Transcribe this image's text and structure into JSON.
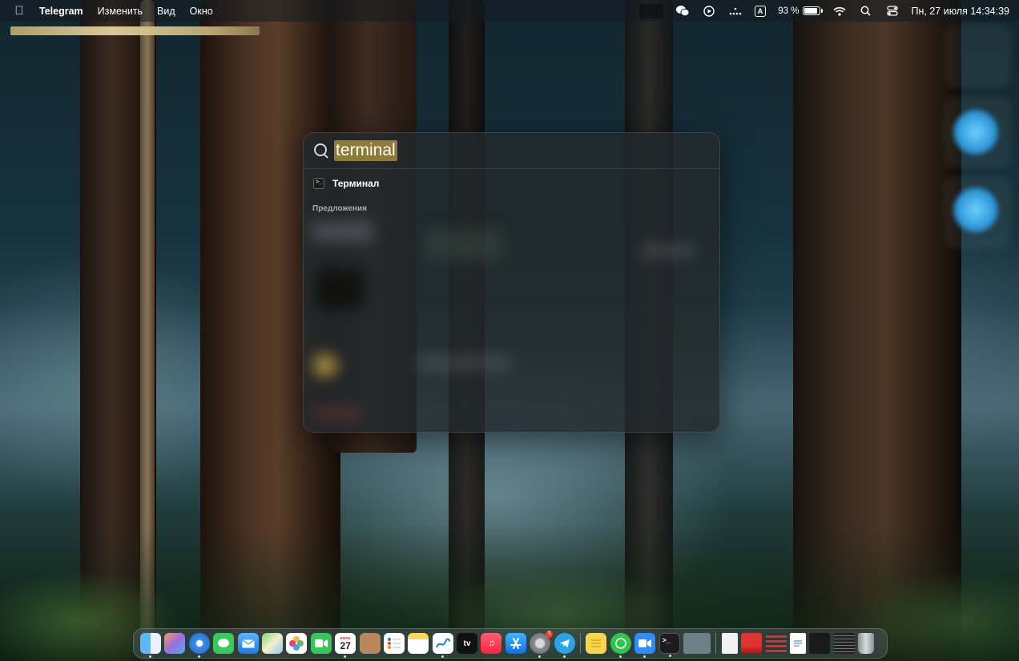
{
  "menubar": {
    "app_name": "Telegram",
    "menus": [
      "Изменить",
      "Вид",
      "Окно"
    ],
    "input_source": "A",
    "battery_percent": "93 %",
    "battery_level": 0.93,
    "datetime": "Пн, 27 июля  14:34:39",
    "icons": [
      "apple-icon",
      "wechat-icon",
      "play-icon",
      "dots-icon",
      "wifi-icon",
      "search-icon",
      "control-center-icon"
    ]
  },
  "spotlight": {
    "query": "terminal",
    "top_result": "Терминал",
    "suggestions_label": "Предложения"
  },
  "dock": {
    "calendar_month": "июль",
    "calendar_day": "27",
    "tv_label": "tv",
    "settings_badge": "1",
    "items": [
      "finder",
      "launchpad",
      "safari",
      "messages",
      "mail",
      "maps",
      "photos",
      "facetime",
      "calendar",
      "contacts",
      "reminders",
      "notes",
      "freeform",
      "tv",
      "music",
      "app-store",
      "system-settings",
      "telegram",
      "stickies",
      "whatsapp",
      "zoom",
      "terminal",
      "blank-window",
      "document",
      "folder-red",
      "folder-gray",
      "text-file",
      "terminal-window",
      "list-window",
      "trash"
    ]
  },
  "colors": {
    "highlight": "#8e7b3a",
    "accent_blue": "#2a93d6",
    "spotlight_bg": "#22282c"
  }
}
